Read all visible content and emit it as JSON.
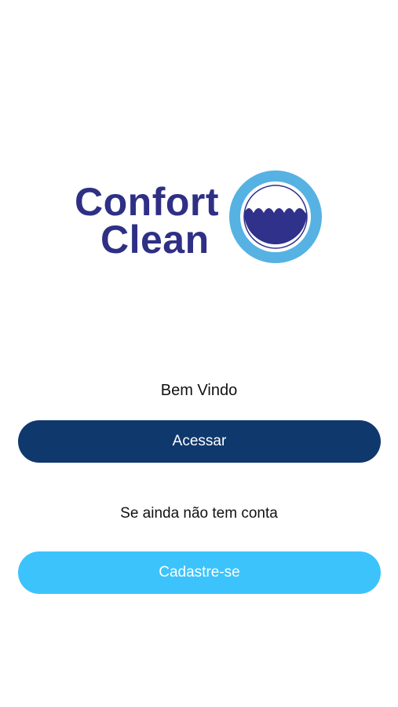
{
  "logo": {
    "line1": "Confort",
    "line2": "Clean",
    "text_color": "#2e2f85",
    "ring_color": "#56b2e2",
    "fill_color": "#2f318a"
  },
  "welcome_text": "Bem Vindo",
  "login_button": {
    "label": "Acessar",
    "color": "#0f386d"
  },
  "no_account_text": "Se ainda não tem conta",
  "signup_button": {
    "label": "Cadastre-se",
    "color": "#3cc3fb"
  }
}
